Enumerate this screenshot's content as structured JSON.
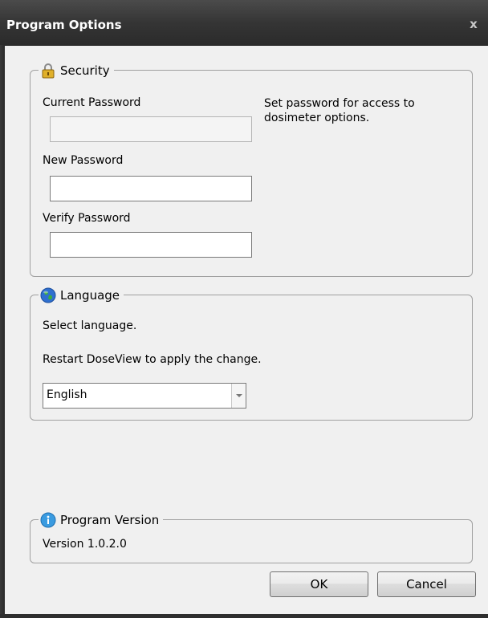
{
  "window": {
    "title": "Program Options",
    "close_glyph": "x"
  },
  "security": {
    "legend": "Security",
    "icon": "lock-icon",
    "current_password_label": "Current Password",
    "current_password_value": "",
    "new_password_label": "New Password",
    "new_password_value": "",
    "verify_password_label": "Verify Password",
    "verify_password_value": "",
    "hint": "Set password for access to dosimeter options."
  },
  "language": {
    "legend": "Language",
    "icon": "globe-icon",
    "select_text": "Select language.",
    "restart_text": "Restart DoseView to apply the change.",
    "selected": "English"
  },
  "version": {
    "legend": "Program Version",
    "icon": "info-icon",
    "text": "Version 1.0.2.0"
  },
  "buttons": {
    "ok": "OK",
    "cancel": "Cancel"
  }
}
